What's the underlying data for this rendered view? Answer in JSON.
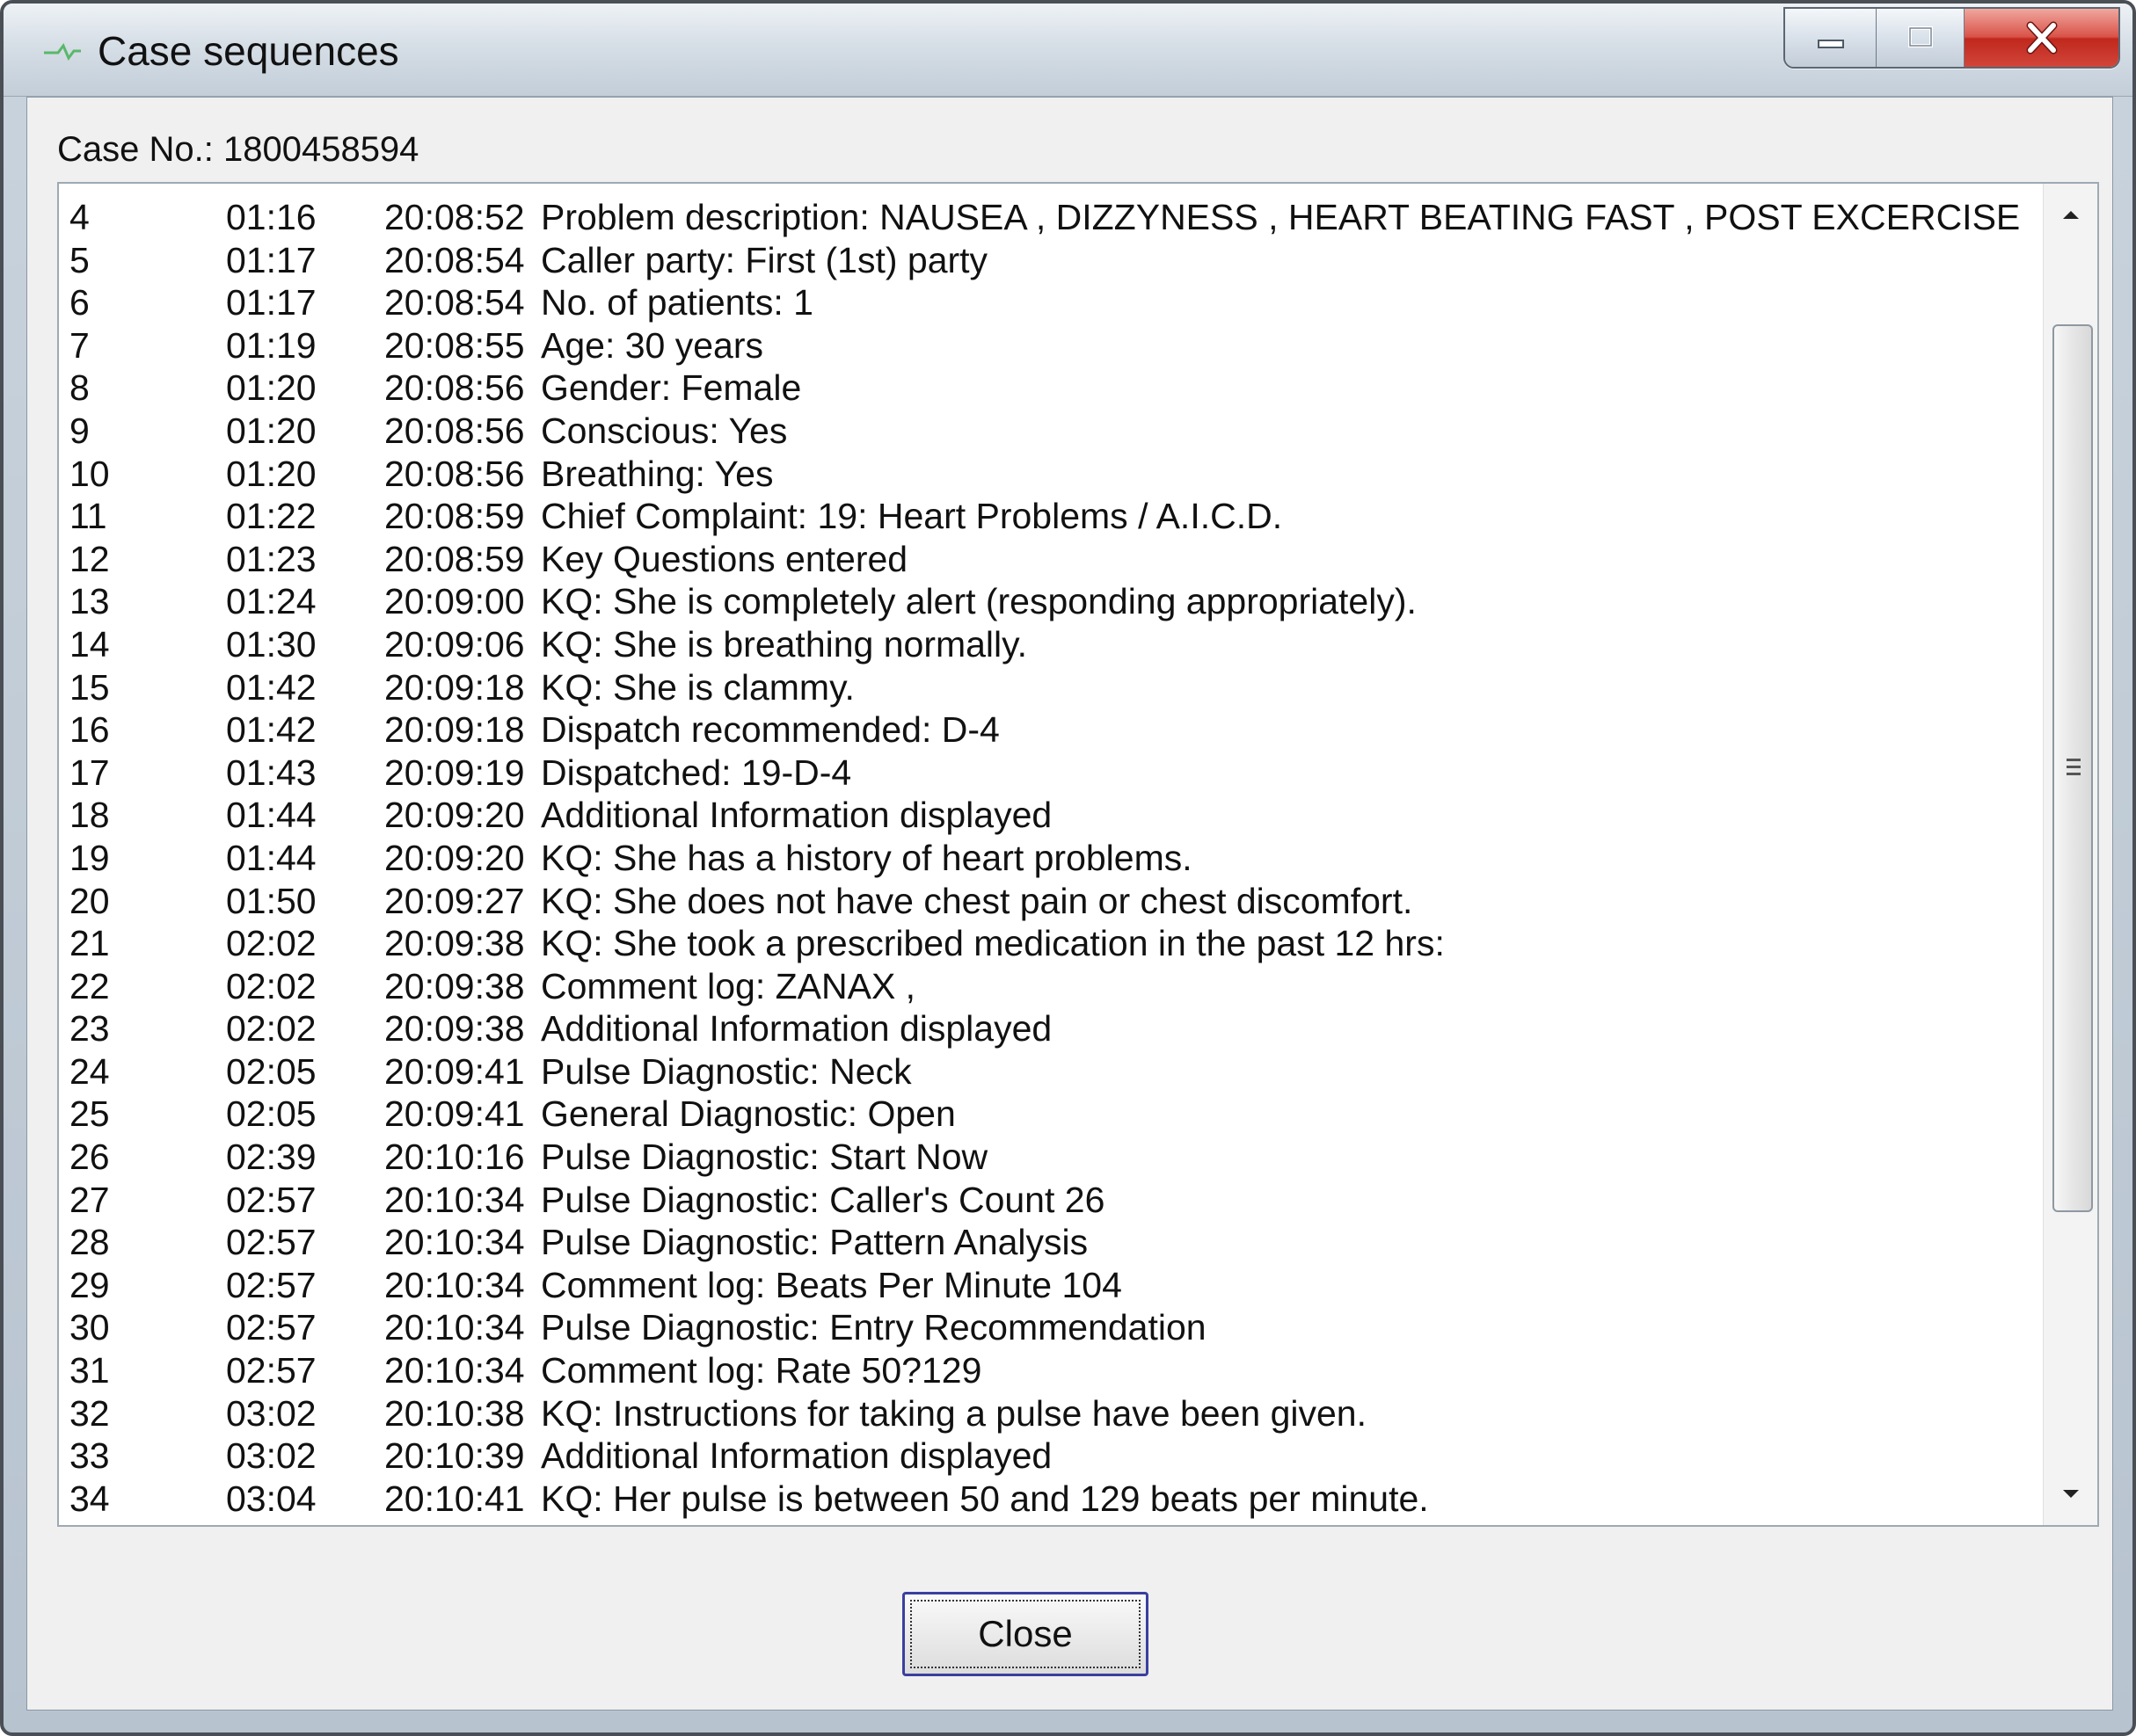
{
  "window": {
    "title": "Case sequences",
    "close_label": "Close"
  },
  "case": {
    "label": "Case No.:",
    "number": "1800458594",
    "full": "Case No.: 1800458594"
  },
  "rows": [
    {
      "num": "4",
      "elapsed": "01:16",
      "time": "20:08:52",
      "desc": "Problem description: NAUSEA , DIZZYNESS , HEART BEATING FAST , POST EXCERCISE"
    },
    {
      "num": "5",
      "elapsed": "01:17",
      "time": "20:08:54",
      "desc": "Caller party: First (1st) party"
    },
    {
      "num": "6",
      "elapsed": "01:17",
      "time": "20:08:54",
      "desc": "No. of patients: 1"
    },
    {
      "num": "7",
      "elapsed": "01:19",
      "time": "20:08:55",
      "desc": "Age: 30 years"
    },
    {
      "num": "8",
      "elapsed": "01:20",
      "time": "20:08:56",
      "desc": "Gender: Female"
    },
    {
      "num": "9",
      "elapsed": "01:20",
      "time": "20:08:56",
      "desc": "Conscious: Yes"
    },
    {
      "num": "10",
      "elapsed": "01:20",
      "time": "20:08:56",
      "desc": "Breathing: Yes"
    },
    {
      "num": "11",
      "elapsed": "01:22",
      "time": "20:08:59",
      "desc": "Chief Complaint: 19: Heart Problems / A.I.C.D."
    },
    {
      "num": "12",
      "elapsed": "01:23",
      "time": "20:08:59",
      "desc": "Key Questions entered"
    },
    {
      "num": "13",
      "elapsed": "01:24",
      "time": "20:09:00",
      "desc": "KQ: She is completely alert (responding appropriately)."
    },
    {
      "num": "14",
      "elapsed": "01:30",
      "time": "20:09:06",
      "desc": "KQ: She is breathing normally."
    },
    {
      "num": "15",
      "elapsed": "01:42",
      "time": "20:09:18",
      "desc": "KQ: She is clammy."
    },
    {
      "num": "16",
      "elapsed": "01:42",
      "time": "20:09:18",
      "desc": "Dispatch recommended: D-4"
    },
    {
      "num": "17",
      "elapsed": "01:43",
      "time": "20:09:19",
      "desc": "Dispatched: 19-D-4"
    },
    {
      "num": "18",
      "elapsed": "01:44",
      "time": "20:09:20",
      "desc": "Additional Information displayed"
    },
    {
      "num": "19",
      "elapsed": "01:44",
      "time": "20:09:20",
      "desc": "KQ: She has a history of heart problems."
    },
    {
      "num": "20",
      "elapsed": "01:50",
      "time": "20:09:27",
      "desc": "KQ: She does not have chest pain or chest discomfort."
    },
    {
      "num": "21",
      "elapsed": "02:02",
      "time": "20:09:38",
      "desc": "KQ: She took a prescribed medication in the past 12 hrs:"
    },
    {
      "num": "22",
      "elapsed": "02:02",
      "time": "20:09:38",
      "desc": "Comment log: ZANAX ,"
    },
    {
      "num": "23",
      "elapsed": "02:02",
      "time": "20:09:38",
      "desc": "Additional Information displayed"
    },
    {
      "num": "24",
      "elapsed": "02:05",
      "time": "20:09:41",
      "desc": "Pulse Diagnostic: Neck"
    },
    {
      "num": "25",
      "elapsed": "02:05",
      "time": "20:09:41",
      "desc": "General Diagnostic: Open"
    },
    {
      "num": "26",
      "elapsed": "02:39",
      "time": "20:10:16",
      "desc": "Pulse Diagnostic: Start Now"
    },
    {
      "num": "27",
      "elapsed": "02:57",
      "time": "20:10:34",
      "desc": "Pulse Diagnostic: Caller's Count 26"
    },
    {
      "num": "28",
      "elapsed": "02:57",
      "time": "20:10:34",
      "desc": "Pulse Diagnostic: Pattern Analysis"
    },
    {
      "num": "29",
      "elapsed": "02:57",
      "time": "20:10:34",
      "desc": "Comment log: Beats Per Minute 104"
    },
    {
      "num": "30",
      "elapsed": "02:57",
      "time": "20:10:34",
      "desc": "Pulse Diagnostic: Entry Recommendation"
    },
    {
      "num": "31",
      "elapsed": "02:57",
      "time": "20:10:34",
      "desc": "Comment log: Rate 50?129"
    },
    {
      "num": "32",
      "elapsed": "03:02",
      "time": "20:10:38",
      "desc": "KQ: Instructions for taking a pulse have been given."
    },
    {
      "num": "33",
      "elapsed": "03:02",
      "time": "20:10:39",
      "desc": "Additional Information displayed"
    },
    {
      "num": "34",
      "elapsed": "03:04",
      "time": "20:10:41",
      "desc": "KQ: Her pulse is between 50 and 129 beats per minute."
    }
  ],
  "scrollbar": {
    "position": 0.42
  },
  "icons": {
    "app": "app-icon",
    "minimize": "minimize-icon",
    "maximize": "maximize-icon",
    "close": "close-icon",
    "scroll_up": "chevron-up-icon",
    "scroll_down": "chevron-down-icon",
    "grip": "grip-icon"
  },
  "colors": {
    "close_accent": "#c42b1c",
    "focus_border": "#3a3fa0"
  }
}
